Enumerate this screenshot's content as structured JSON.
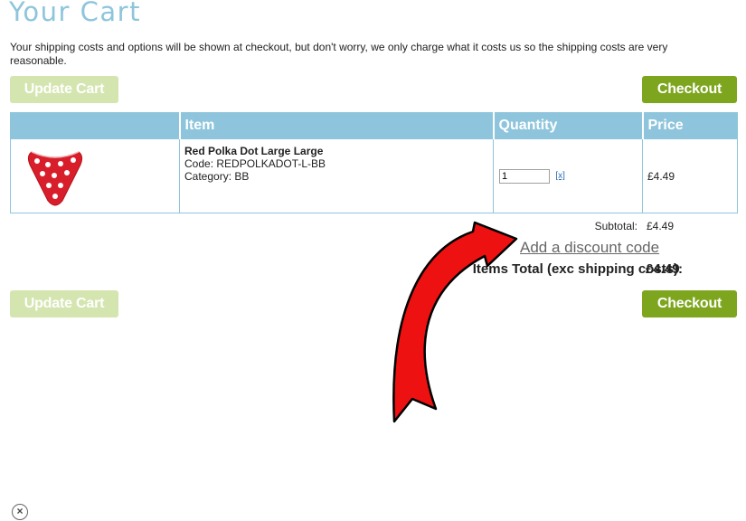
{
  "page": {
    "title": "Your Cart",
    "intro": "Your shipping costs and options will be shown at checkout, but don't worry, we only charge what it costs us so the shipping costs are very reasonable."
  },
  "buttons": {
    "update_cart": "Update Cart",
    "checkout": "Checkout"
  },
  "table": {
    "headers": [
      "",
      "Item",
      "Quantity",
      "Price"
    ],
    "rows": [
      {
        "image": "red-polka-dot-bib-image",
        "name": "Red Polka Dot Large Large",
        "code": "Code: REDPOLKADOT-L-BB",
        "category": "Category: BB",
        "quantity": "1",
        "remove_label": "[x]",
        "price": "£4.49"
      }
    ]
  },
  "summary": {
    "subtotal_label": "Subtotal:",
    "subtotal_value": "£4.49",
    "discount_link": "Add a discount code",
    "total_label": "Items Total (exc shipping costs):",
    "total_value": "£4.49"
  },
  "overlay": {
    "arrow": "red-curved-arrow-annotation"
  },
  "close": {
    "label": "×"
  },
  "colors": {
    "title": "#8ec5dc",
    "table_header": "#8ec5dc",
    "checkout_button": "#7da51e",
    "update_button": "#d4e5b0",
    "arrow": "#ee1111"
  }
}
